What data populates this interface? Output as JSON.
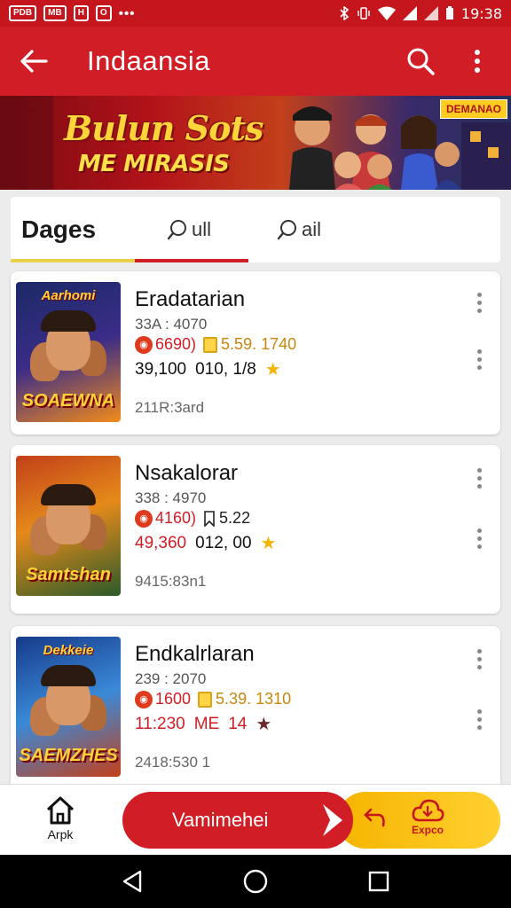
{
  "status_bar": {
    "chips": [
      "PDB",
      "MB",
      "H",
      "O"
    ],
    "dots": "•••",
    "time": "19:38"
  },
  "app_bar": {
    "title": "Indaansia"
  },
  "banner": {
    "headline": "Bulun Sots",
    "subline": "ME MIRASIS",
    "badge": "DEMANAO"
  },
  "tabs": [
    {
      "label": "Dages"
    },
    {
      "label": "ull"
    },
    {
      "label": "ail"
    }
  ],
  "cards": [
    {
      "title": "Eradatarian",
      "code": "33A : 4070",
      "price": "6690)",
      "rating_text": "5.59. 1740",
      "stat_a": "39,100",
      "stat_b": "010, 1/8",
      "footer": "211R:3ard",
      "thumb_top": "Aarhomi",
      "thumb_bottom": "SOAEWNA",
      "colors": [
        "#1b2a66",
        "#3b2c88",
        "#f28b1a"
      ]
    },
    {
      "title": "Nsakalorar",
      "code": "338 : 4970",
      "price": "4160)",
      "rating_text": "5.22",
      "stat_a": "49,360",
      "stat_b": "012, 00",
      "footer": "9415:83n1",
      "thumb_top": "",
      "thumb_bottom": "Samtshan",
      "colors": [
        "#c2401a",
        "#e58a1a",
        "#2b5a2a"
      ]
    },
    {
      "title": "Endkalrlaran",
      "code": "239 : 2070",
      "price": "1600",
      "rating_text": "5.39. 1310",
      "stat_a": "11:230",
      "stat_b": "ME",
      "stat_c": "14",
      "footer": "2418:530 1",
      "thumb_top": "Dekkeie",
      "thumb_bottom": "SAEMZHES",
      "colors": [
        "#173a8a",
        "#3a8ad8",
        "#c2401a"
      ]
    }
  ],
  "bottom_bar": {
    "home_label": "Arpk",
    "primary_label": "Vamimehei",
    "secondary_label": "Expco"
  }
}
